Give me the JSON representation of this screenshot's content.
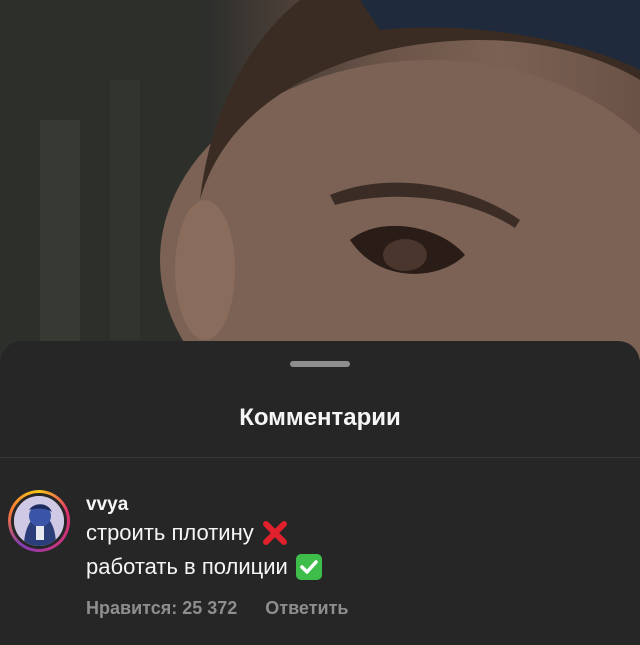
{
  "sheet": {
    "title": "Комментарии"
  },
  "comment": {
    "username": "vvya",
    "line1": "строить плотину",
    "line1_icon": "cross-mark-icon",
    "line2": "работать в полиции",
    "line2_icon": "check-mark-button-icon",
    "likes_label": "Нравится: 25 372",
    "reply_label": "Ответить"
  },
  "colors": {
    "sheet_background": "#262626",
    "primary_text": "#f5f5f5",
    "secondary_text": "#8e8e8e",
    "cross": "#e0202a",
    "check": "#3fbd4a"
  }
}
